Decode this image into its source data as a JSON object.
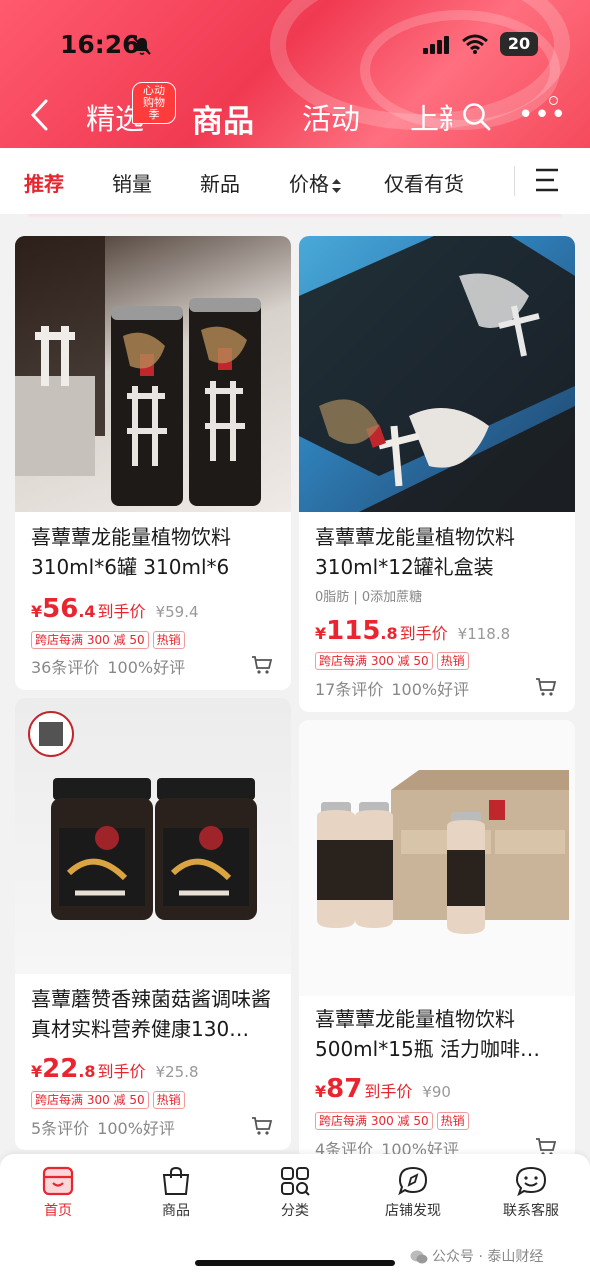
{
  "status": {
    "time": "16:26",
    "battery": "20"
  },
  "nav": {
    "tabs": [
      "精选",
      "商品",
      "活动",
      "上新"
    ],
    "active": "商品",
    "badge": "心动购物季"
  },
  "filter": {
    "items": [
      "推荐",
      "销量",
      "新品",
      "价格",
      "仅看有货"
    ],
    "active": "推荐"
  },
  "products": [
    {
      "title": "喜蕈蕈龙能量植物饮料310ml*6罐 310ml*6",
      "subtitle": "",
      "price_int": "56",
      "price_dec": ".4",
      "price_label": "到手价",
      "original": "¥59.4",
      "tags": [
        "跨店每满 300 减 50",
        "热销"
      ],
      "review_count": "36条评价",
      "rating": "100%好评"
    },
    {
      "title": "喜蕈蕈龙能量植物饮料310ml*12罐礼盒装",
      "subtitle": "0脂肪 | 0添加蔗糖",
      "price_int": "115",
      "price_dec": ".8",
      "price_label": "到手价",
      "original": "¥118.8",
      "tags": [
        "跨店每满 300 减 50",
        "热销"
      ],
      "review_count": "17条评价",
      "rating": "100%好评"
    },
    {
      "title": "喜蕈蘑赞香辣菌菇酱调味酱真材实料营养健康130…",
      "subtitle": "",
      "price_int": "22",
      "price_dec": ".8",
      "price_label": "到手价",
      "original": "¥25.8",
      "tags": [
        "跨店每满 300 减 50",
        "热销"
      ],
      "review_count": "5条评价",
      "rating": "100%好评"
    },
    {
      "title": "喜蕈蕈龙能量植物饮料500ml*15瓶 活力咖啡…",
      "subtitle": "",
      "price_int": "87",
      "price_dec": "",
      "price_label": "到手价",
      "original": "¥90",
      "tags": [
        "跨店每满 300 减 50",
        "热销"
      ],
      "review_count": "4条评价",
      "rating": "100%好评"
    }
  ],
  "currency": "¥",
  "bottom_tabs": [
    "首页",
    "商品",
    "分类",
    "店铺发现",
    "联系客服"
  ],
  "watermark": "公众号 · 泰山财经",
  "colors": {
    "accent": "#e8262f",
    "header": "#f03a52"
  }
}
